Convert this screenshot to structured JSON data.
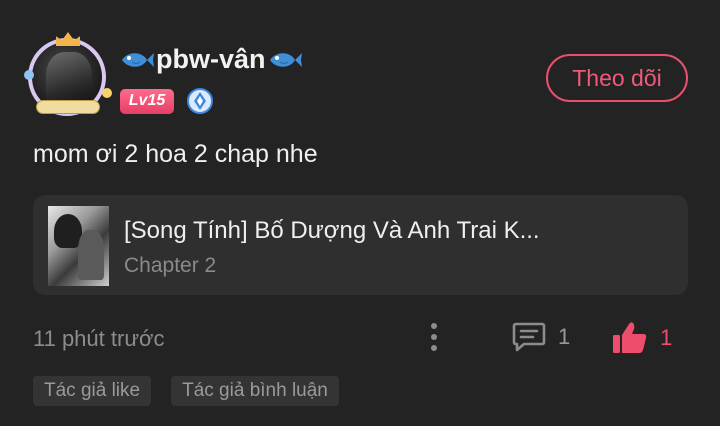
{
  "user": {
    "name": "pbw-vân",
    "level": "Lv15"
  },
  "follow_button": {
    "label": "Theo dõi"
  },
  "comment": {
    "text": "mom ơi 2 hoa 2 chap nhe"
  },
  "chapter_card": {
    "title": "[Song Tính] Bố Dượng Và Anh Trai K...",
    "chapter": "Chapter 2"
  },
  "footer": {
    "timestamp": "11 phút trước",
    "reply_count": "1",
    "like_count": "1",
    "tags": [
      "Tác giả like",
      "Tác giả bình luận"
    ]
  },
  "colors": {
    "background": "#232323",
    "accent": "#ee4d6c",
    "card": "#2f2f2f",
    "muted_text": "#8c8c8c"
  },
  "icons": {
    "fish": "fish-icon",
    "rank": "rank-badge-icon",
    "more": "more-vertical-icon",
    "comment": "comment-icon",
    "like": "thumbs-up-icon"
  }
}
